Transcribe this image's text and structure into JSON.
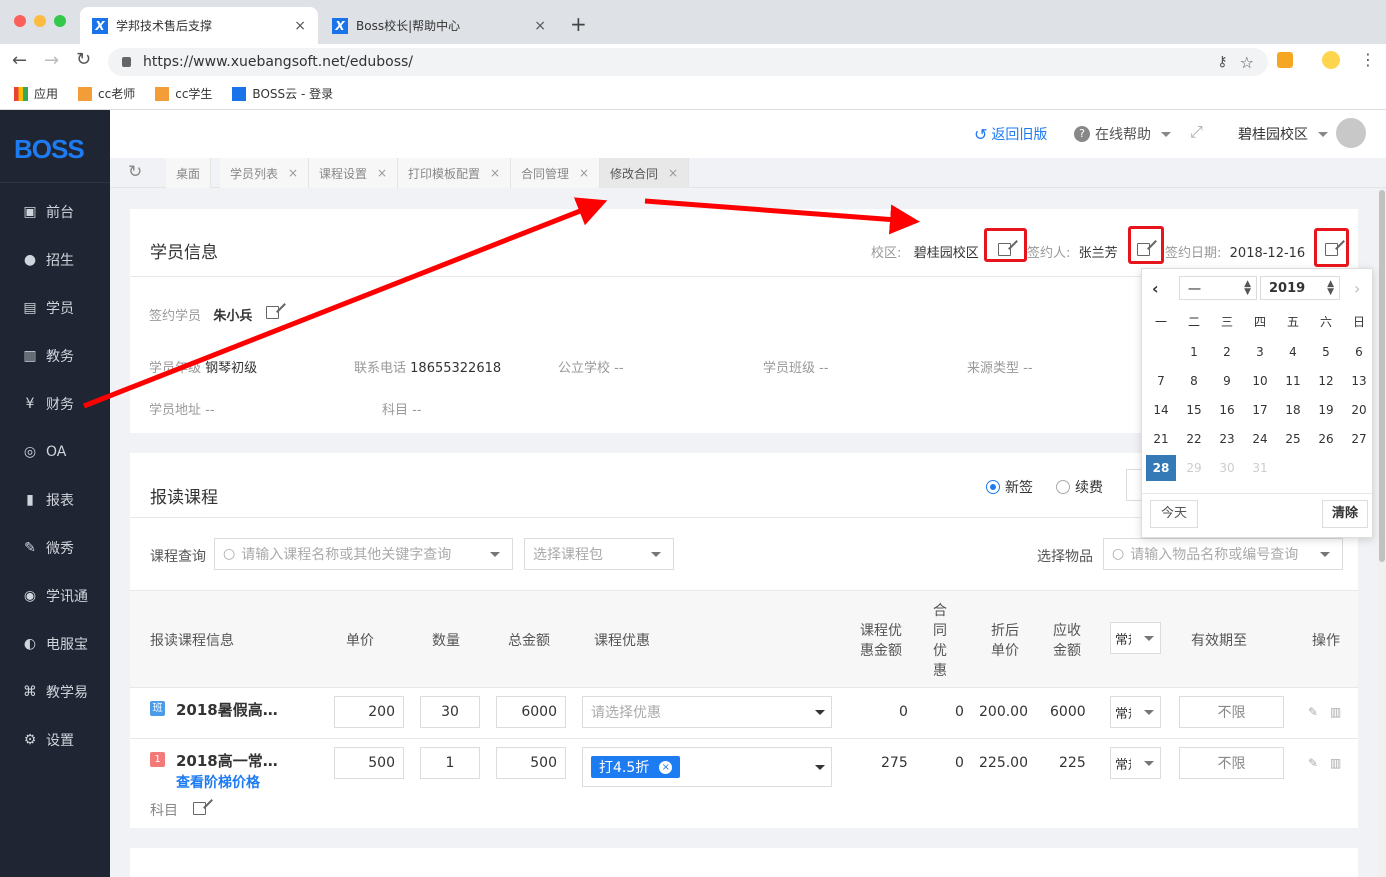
{
  "browser": {
    "tabs": [
      {
        "title": "学邦技术售后支撑",
        "active": true
      },
      {
        "title": "Boss校长|帮助中心",
        "active": false
      }
    ],
    "new_tab": "+",
    "url": "https://www.xuebangsoft.net/eduboss/",
    "bookmarks": [
      "应用",
      "cc老师",
      "cc学生",
      "BOSS云 - 登录"
    ]
  },
  "sidebar": {
    "logo": "BOSS",
    "items": [
      "前台",
      "招生",
      "学员",
      "教务",
      "财务",
      "OA",
      "报表",
      "微秀",
      "学讯通",
      "电服宝",
      "教学易",
      "设置"
    ]
  },
  "header": {
    "back_old": "返回旧版",
    "help": "在线帮助",
    "campus": "碧桂园校区"
  },
  "page_tabs": [
    {
      "label": "桌面",
      "closable": false
    },
    {
      "label": "学员列表",
      "closable": true
    },
    {
      "label": "课程设置",
      "closable": true
    },
    {
      "label": "打印模板配置",
      "closable": true
    },
    {
      "label": "合同管理",
      "closable": true
    },
    {
      "label": "修改合同",
      "closable": true,
      "active": true
    }
  ],
  "student_info": {
    "title": "学员信息",
    "campus_label": "校区:",
    "campus_value": "碧桂园校区",
    "signer_label": "签约人:",
    "signer_value": "张兰芳",
    "date_label": "签约日期:",
    "date_value": "2018-12-16",
    "student_label": "签约学员",
    "student_value": "朱小兵",
    "grade_label": "学员年级",
    "grade_value": "钢琴初级",
    "phone_label": "联系电话",
    "phone_value": "18655322618",
    "school_label": "公立学校",
    "school_value": "--",
    "class_label": "学员班级",
    "class_value": "--",
    "source_label": "来源类型",
    "source_value": "--",
    "address_label": "学员地址",
    "address_value": "--",
    "subject_label": "科目",
    "subject_value": "--"
  },
  "calendar": {
    "month": "一",
    "year": "2019",
    "weekdays": [
      "一",
      "二",
      "三",
      "四",
      "五",
      "六",
      "日"
    ],
    "days": [
      "1",
      "2",
      "3",
      "4",
      "5",
      "6",
      "7",
      "8",
      "9",
      "10",
      "11",
      "12",
      "13",
      "14",
      "15",
      "16",
      "17",
      "18",
      "19",
      "20",
      "21",
      "22",
      "23",
      "24",
      "25",
      "26",
      "27",
      "28",
      "29",
      "30",
      "31"
    ],
    "first_col": 1,
    "selected": "28",
    "today_btn": "今天",
    "clear_btn": "清除"
  },
  "courses": {
    "title": "报读课程",
    "radio_new": "新签",
    "radio_renew": "续费",
    "search_label": "课程查询",
    "search_placeholder": "请输入课程名称或其他关键字查询",
    "package_placeholder": "选择课程包",
    "goods_label": "选择物品",
    "goods_placeholder": "请输入物品名称或编号查询",
    "headers": {
      "info": "报读课程信息",
      "price": "单价",
      "qty": "数量",
      "total": "总金额",
      "discount": "课程优惠",
      "disc_amount_1": "课程优",
      "disc_amount_2": "惠金额",
      "contract_disc": [
        "合",
        "同",
        "优",
        "惠"
      ],
      "after_price_1": "折后",
      "after_price_2": "单价",
      "receivable_1": "应收",
      "receivable_2": "金额",
      "type": "常规",
      "expire": "有效期至",
      "op": "操作"
    },
    "rows": [
      {
        "badge": "班",
        "name": "2018暑假高…",
        "price": "200",
        "qty": "30",
        "total": "6000",
        "discount_placeholder": "请选择优惠",
        "disc_amount": "0",
        "contract_disc": "0",
        "after_price": "200.00",
        "receivable": "6000",
        "type": "常规",
        "expire": "不限"
      },
      {
        "badge": "1",
        "name": "2018高一常…",
        "link": "查看阶梯价格",
        "price": "500",
        "qty": "1",
        "total": "500",
        "discount_tag": "打4.5折",
        "disc_amount": "275",
        "contract_disc": "0",
        "after_price": "225.00",
        "receivable": "225",
        "type": "常规",
        "expire": "不限",
        "subject_label": "科目"
      }
    ]
  },
  "colors": {
    "accent": "#1e7cf2",
    "sidebar": "#1f2532",
    "annotation": "#e8141b"
  }
}
